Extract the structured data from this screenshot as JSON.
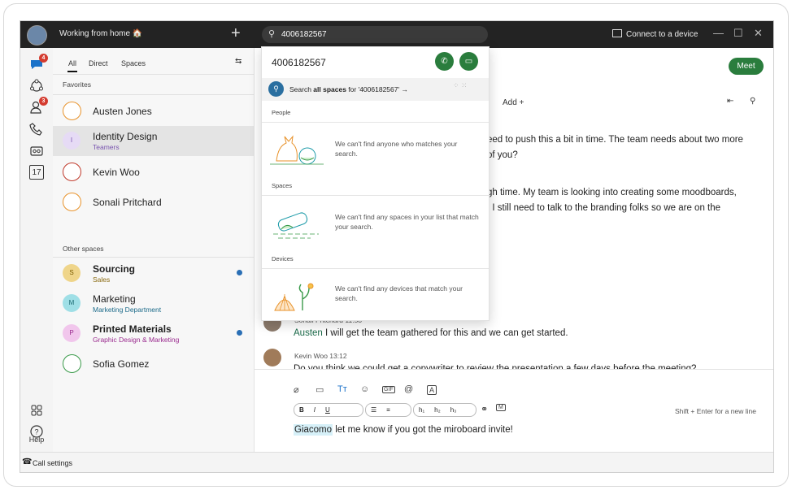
{
  "titlebar": {
    "status": "Working from home 🏠",
    "search_value": "4006182567",
    "connect": "Connect to a device"
  },
  "rail": {
    "messages_badge": "4",
    "contacts_badge": "3",
    "calendar_day": "17",
    "help_label": "Help"
  },
  "list": {
    "tabs": [
      "All",
      "Direct",
      "Spaces"
    ],
    "favorites_header": "Favorites",
    "other_header": "Other spaces",
    "favorites": [
      {
        "name": "Austen Jones",
        "sub": "",
        "initial": ""
      },
      {
        "name": "Identity Design",
        "sub": "Teamers",
        "initial": "I"
      },
      {
        "name": "Kevin Woo",
        "sub": "",
        "initial": ""
      },
      {
        "name": "Sonali Pritchard",
        "sub": "",
        "initial": ""
      }
    ],
    "others": [
      {
        "name": "Sourcing",
        "sub": "Sales",
        "initial": "S",
        "unread": true
      },
      {
        "name": "Marketing",
        "sub": "Marketing Department",
        "initial": "M",
        "unread": false
      },
      {
        "name": "Printed Materials",
        "sub": "Graphic Design & Marketing",
        "initial": "P",
        "unread": true
      },
      {
        "name": "Sofia Gomez",
        "sub": "",
        "initial": "",
        "unread": false
      }
    ]
  },
  "main": {
    "meet": "Meet",
    "add_tab": "Add  +",
    "msg1_line1": "eed to push this a bit in time. The team needs about two more",
    "msg1_line2": "of you?",
    "msg2_line1": "gh time. My team is looking into creating some moodboards,",
    "msg2_line2": ". I still need to talk to the branding folks so we are on the",
    "msg3_meta": "Sonali Pritchard   11:58",
    "msg3_mention": "Austen",
    "msg3_text": " I will get the team gathered for this and we can get started.",
    "msg4_meta": "Kevin Woo   13:12",
    "msg4_text": "Do you think we could get a copywriter to review the presentation a few days before the meeting?"
  },
  "composer": {
    "hint": "Shift + Enter for a new line",
    "draft_mention": "Giacomo",
    "draft_text": " let me know if you got the miroboard invite!"
  },
  "bottombar": {
    "label": "Call settings"
  },
  "dropdown": {
    "number": "4006182567",
    "search_prefix": "Search ",
    "search_bold": "all spaces",
    "search_suffix": " for '4006182567'  →",
    "people_header": "People",
    "people_empty": "We can't find anyone who matches your search.",
    "spaces_header": "Spaces",
    "spaces_empty": "We can't find any spaces in your list that match your search.",
    "devices_header": "Devices",
    "devices_empty": "We can't find any devices that match your search."
  },
  "colors": {
    "accent_green": "#2a7d3d",
    "badge_red": "#d43b2f",
    "unread_blue": "#2a6fb5"
  }
}
